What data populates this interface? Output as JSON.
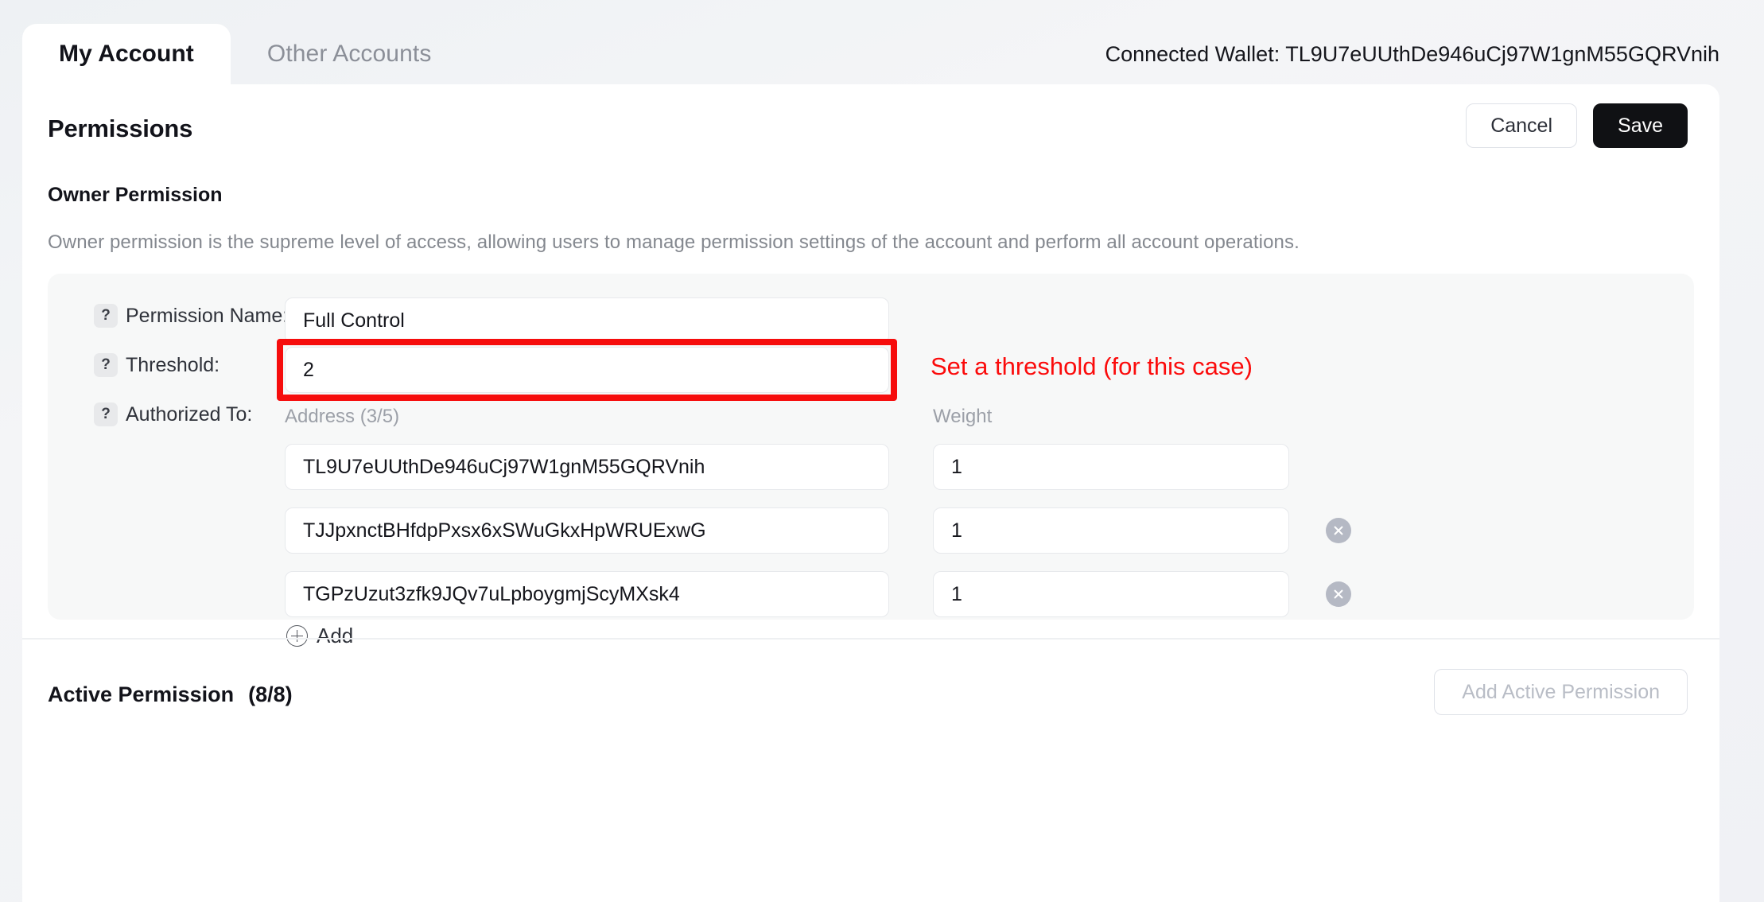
{
  "tabs": [
    {
      "label": "My Account",
      "active": true
    },
    {
      "label": "Other Accounts",
      "active": false
    }
  ],
  "header": {
    "connected_wallet_label": "Connected Wallet:",
    "connected_wallet_address": "TL9U7eUUthDe946uCj97W1gnM55GQRVnih",
    "connected_wallet_full": "Connected Wallet: TL9U7eUUthDe946uCj97W1gnM55GQRVnih"
  },
  "page": {
    "title": "Permissions",
    "cancel_label": "Cancel",
    "save_label": "Save"
  },
  "owner_permission": {
    "section_title": "Owner Permission",
    "description": "Owner permission is the supreme level of access, allowing users to manage permission settings of the account and perform all account operations.",
    "fields": {
      "permission_name_label": "Permission Name:",
      "permission_name_value": "Full Control",
      "threshold_label": "Threshold:",
      "threshold_value": "2",
      "authorized_to_label": "Authorized To:",
      "help_icon": "?"
    },
    "columns": {
      "address": "Address (3/5)",
      "weight": "Weight"
    },
    "rows": [
      {
        "address": "TL9U7eUUthDe946uCj97W1gnM55GQRVnih",
        "weight": "1",
        "deletable": false
      },
      {
        "address": "TJJpxnctBHfdpPxsx6xSWuGkxHpWRUExwG",
        "weight": "1",
        "deletable": true
      },
      {
        "address": "TGPzUzut3zfk9JQv7uLpboygmjScyMXsk4",
        "weight": "1",
        "deletable": true
      }
    ],
    "add_label": "Add"
  },
  "annotation": {
    "threshold_note": "Set a threshold (for this case)",
    "color": "#fb0b0b"
  },
  "active_permission": {
    "title": "Active Permission",
    "count": "(8/8)",
    "add_button_label": "Add Active Permission"
  }
}
